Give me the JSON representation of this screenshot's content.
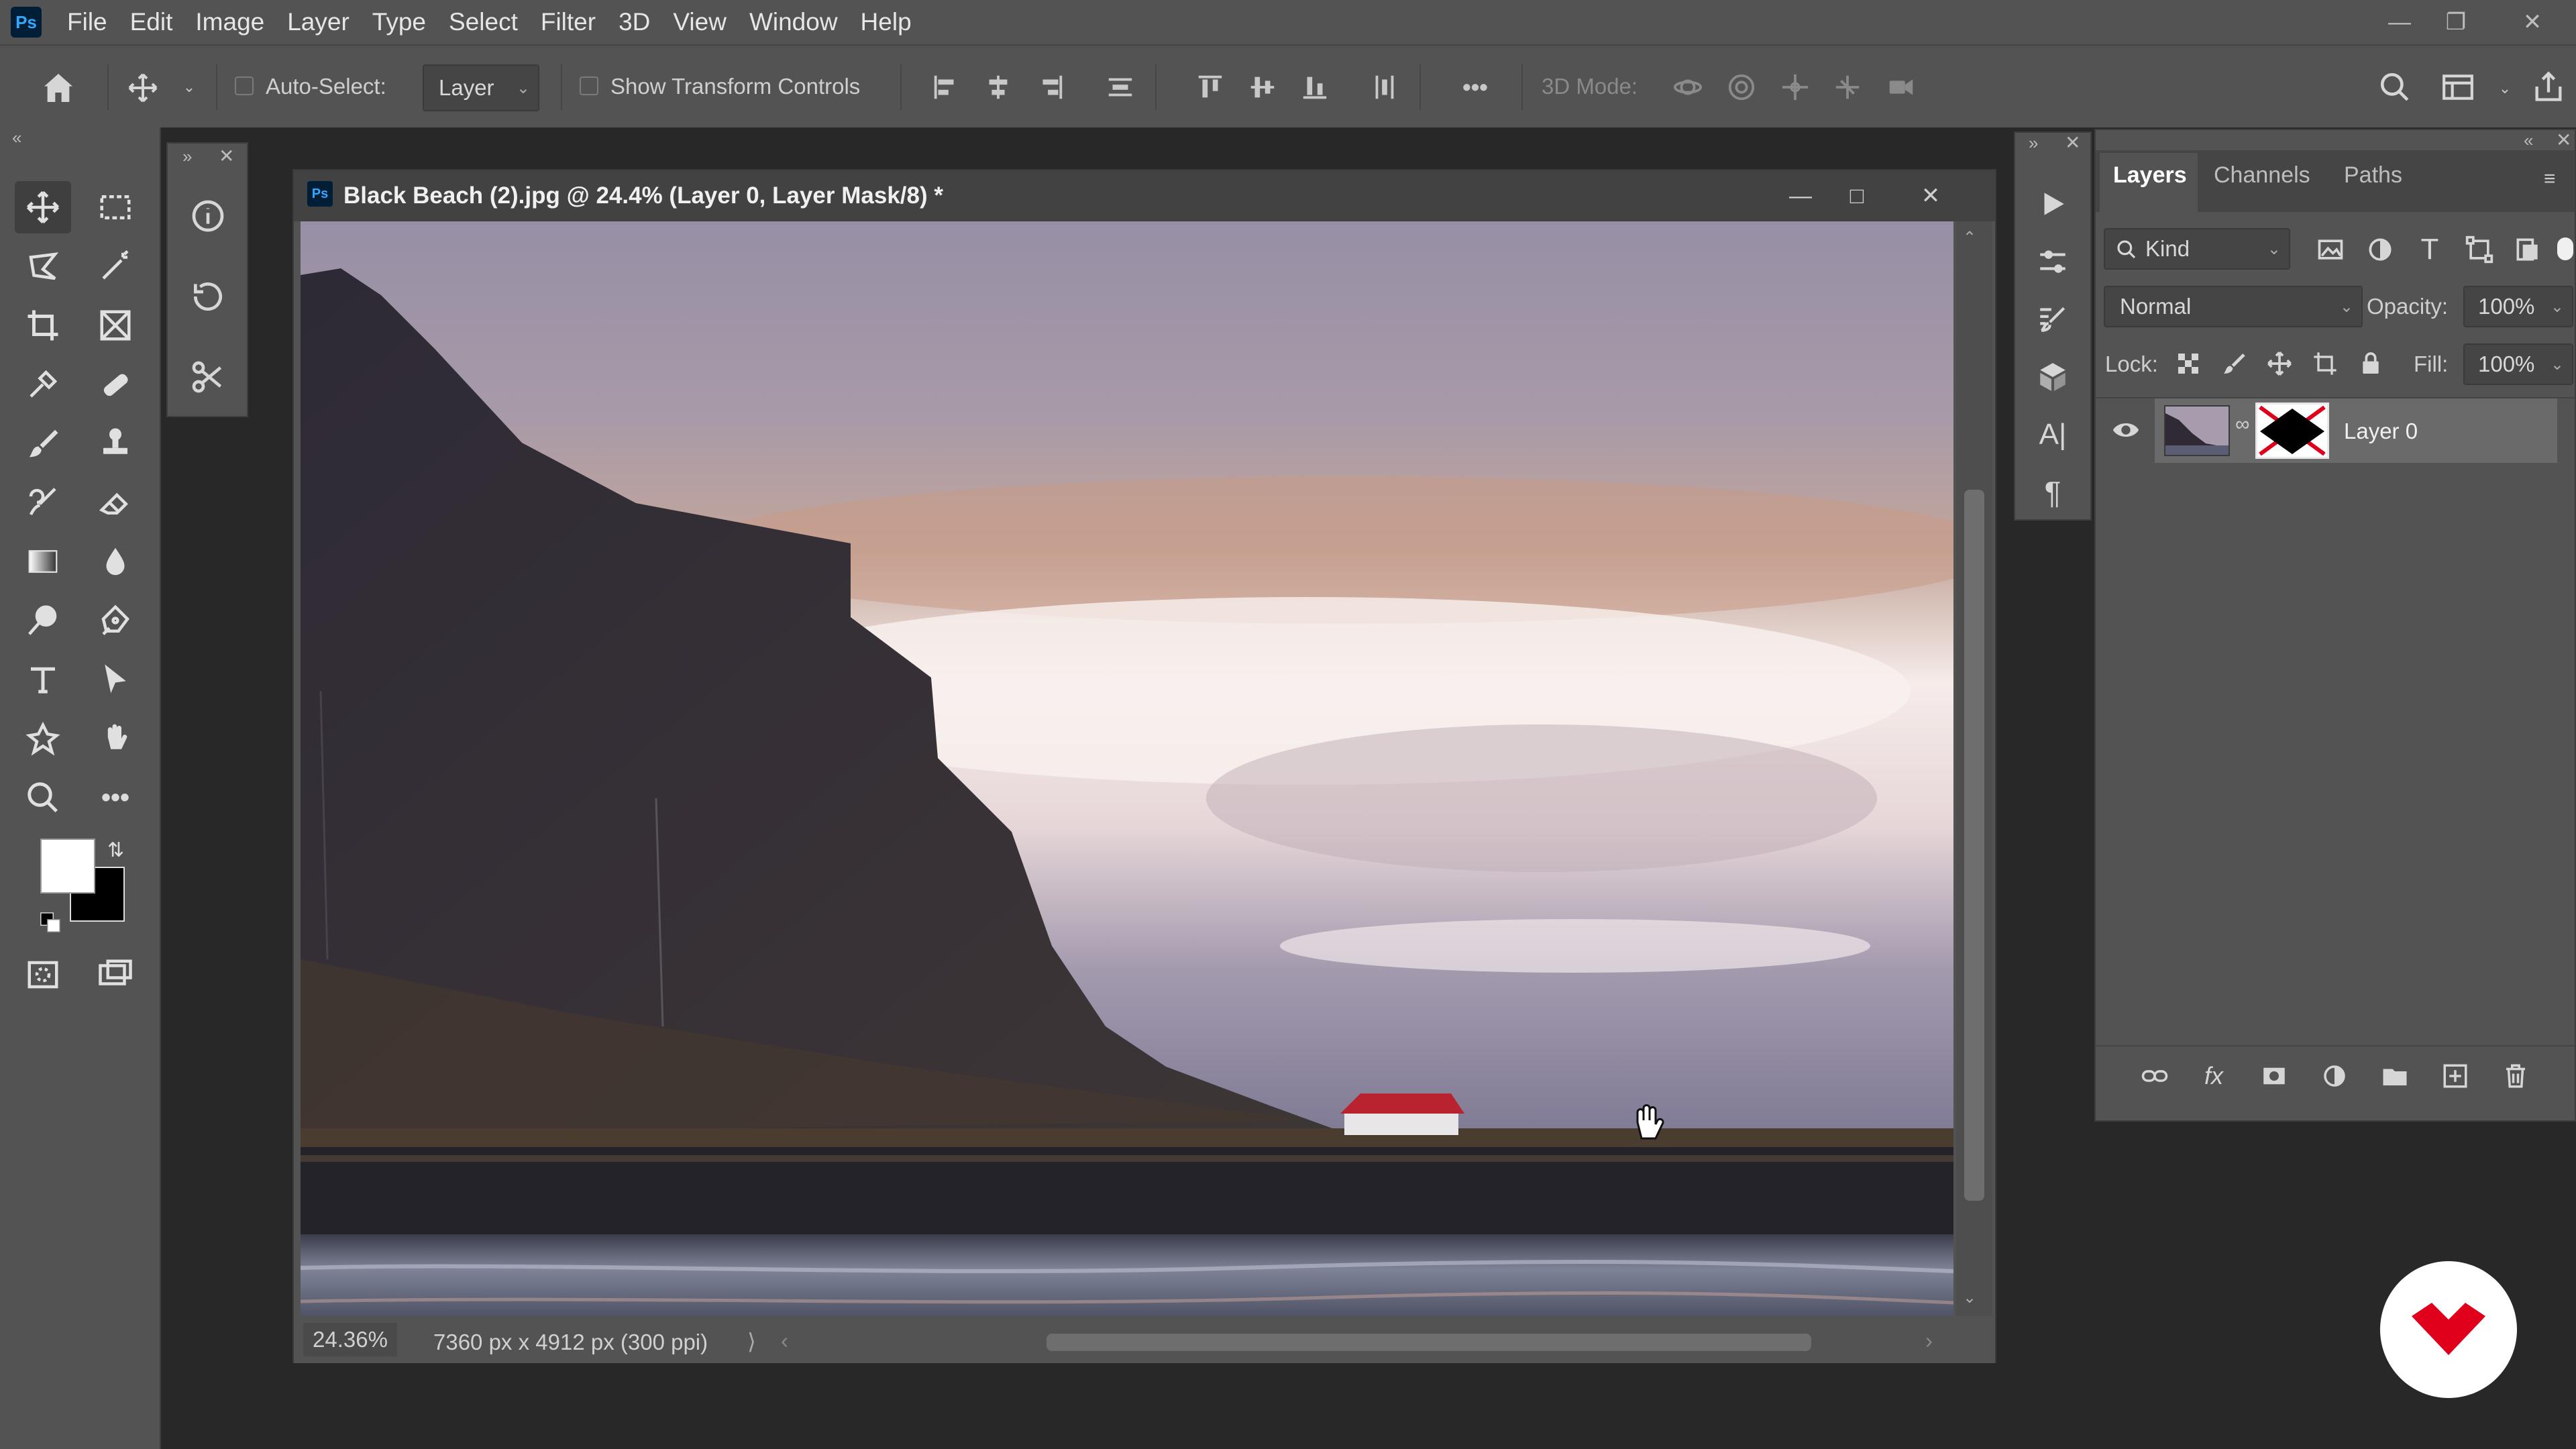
{
  "app": {
    "logo_text": "Ps"
  },
  "menu": [
    "File",
    "Edit",
    "Image",
    "Layer",
    "Type",
    "Select",
    "Filter",
    "3D",
    "View",
    "Window",
    "Help"
  ],
  "options_bar": {
    "auto_select_label": "Auto-Select:",
    "auto_select_value": "Layer",
    "show_transform_label": "Show Transform Controls",
    "more_label": "•••",
    "mode_3d_label": "3D Mode:"
  },
  "document": {
    "title": "Black Beach (2).jpg @ 24.4% (Layer 0, Layer Mask/8) *",
    "zoom": "24.36%",
    "dimensions": "7360 px x 4912 px (300 ppi)"
  },
  "layers_panel": {
    "tabs": [
      "Layers",
      "Channels",
      "Paths"
    ],
    "active_tab": "Layers",
    "filter_kind": "Kind",
    "blend_mode": "Normal",
    "opacity_label": "Opacity:",
    "opacity_value": "100%",
    "lock_label": "Lock:",
    "fill_label": "Fill:",
    "fill_value": "100%",
    "layers": [
      {
        "name": "Layer 0",
        "visible": true,
        "has_mask": true
      }
    ]
  },
  "colors": {
    "ui_panel": "#535353",
    "ui_bg": "#282828",
    "brand_red": "#e0001b",
    "foreground_swatch": "#ffffff",
    "background_swatch": "#000000"
  }
}
